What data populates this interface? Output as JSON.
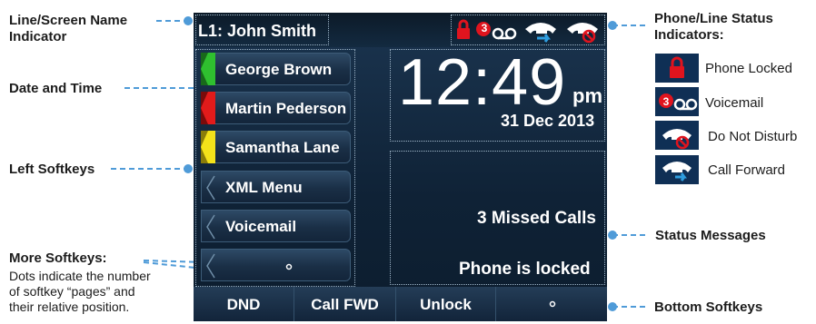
{
  "annotations": {
    "line_screen_name": "Line/Screen Name\nIndicator",
    "date_time": "Date and Time",
    "left_softkeys": "Left Softkeys",
    "more_softkeys_title": "More Softkeys:",
    "more_softkeys_desc": "Dots indicate the number\nof softkey “pages” and\ntheir relative position.",
    "phone_status": "Phone/Line Status\nIndicators:",
    "status_messages": "Status Messages",
    "bottom_softkeys": "Bottom Softkeys"
  },
  "legend": [
    {
      "icon": "lock-icon",
      "label": "Phone Locked"
    },
    {
      "icon": "voicemail-icon",
      "label": "Voicemail"
    },
    {
      "icon": "do-not-disturb-icon",
      "label": "Do Not Disturb"
    },
    {
      "icon": "call-forward-icon",
      "label": "Call Forward"
    }
  ],
  "screen": {
    "line_name": "L1: John Smith",
    "voicemail_count": "3",
    "time": "12:49",
    "ampm": "pm",
    "date": "31 Dec 2013",
    "missed_calls": "3 Missed Calls",
    "lock_message": "Phone is locked",
    "left_softkeys": [
      {
        "label": "George Brown",
        "color": "#2fbf2f"
      },
      {
        "label": "Martin Pederson",
        "color": "#e21b1b"
      },
      {
        "label": "Samantha Lane",
        "color": "#f3e21a"
      },
      {
        "label": "XML Menu",
        "color": ""
      },
      {
        "label": "Voicemail",
        "color": ""
      },
      {
        "label": "",
        "color": ""
      }
    ],
    "bottom_softkeys": [
      "DND",
      "Call FWD",
      "Unlock",
      ""
    ]
  },
  "colors": {
    "accent_line": "#3d8fd6",
    "screen_bg": "#13263b",
    "icon_red": "#e0141e",
    "icon_blue": "#2f9ee0"
  }
}
